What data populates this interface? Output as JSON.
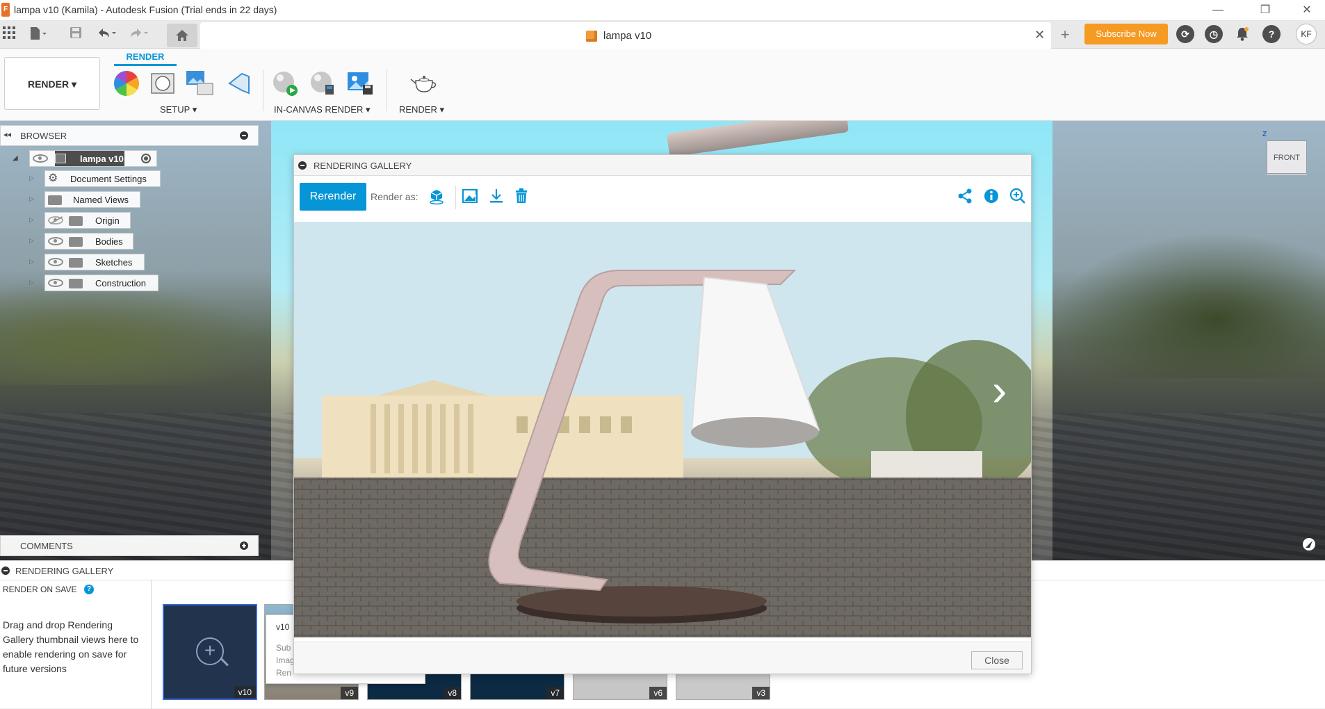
{
  "window": {
    "title": "lampa v10 (Kamila) - Autodesk Fusion (Trial ends in 22 days)",
    "logo_letter": "F",
    "minimize": "—",
    "restore": "❐",
    "close": "✕"
  },
  "tabbar": {
    "doc_tab_label": "lampa v10",
    "close_glyph": "✕",
    "new_tab_glyph": "+",
    "subscribe_label": "Subscribe Now",
    "avatar_initials": "KF",
    "help_glyph": "?"
  },
  "toolbar": {
    "workspace_label": "RENDER ▾",
    "active_tab": "RENDER",
    "groups": [
      {
        "label": "SETUP ▾"
      },
      {
        "label": "IN-CANVAS RENDER ▾"
      },
      {
        "label": "RENDER ▾"
      }
    ]
  },
  "browser": {
    "title": "BROWSER",
    "root": {
      "label": "lampa v10"
    },
    "items": [
      {
        "label": "Document Settings"
      },
      {
        "label": "Named Views"
      },
      {
        "label": "Origin"
      },
      {
        "label": "Bodies"
      },
      {
        "label": "Sketches"
      },
      {
        "label": "Construction"
      }
    ]
  },
  "comments": {
    "title": "COMMENTS"
  },
  "viewcube": {
    "face": "FRONT",
    "axis": "Z"
  },
  "gallery_strip": {
    "title": "RENDERING GALLERY",
    "render_on_save": "RENDER ON SAVE",
    "help_glyph": "?",
    "description": "Drag and drop Rendering Gallery thumbnail views here to enable rendering on save for future versions",
    "thumbnails": [
      {
        "label": "v10"
      },
      {
        "label": "v9"
      },
      {
        "label": "v8"
      },
      {
        "label": "v7"
      },
      {
        "label": "v6"
      },
      {
        "label": "v3"
      }
    ]
  },
  "tooltip": {
    "version": "v10",
    "line1": "Sub",
    "line2": "Imag",
    "line3": "Ren"
  },
  "dialog": {
    "title": "RENDERING GALLERY",
    "rerender_label": "Rerender",
    "render_as_label": "Render as:",
    "close_label": "Close",
    "next_glyph": "›"
  },
  "colors": {
    "accent": "#0696d7",
    "subscribe": "#f59a22"
  }
}
